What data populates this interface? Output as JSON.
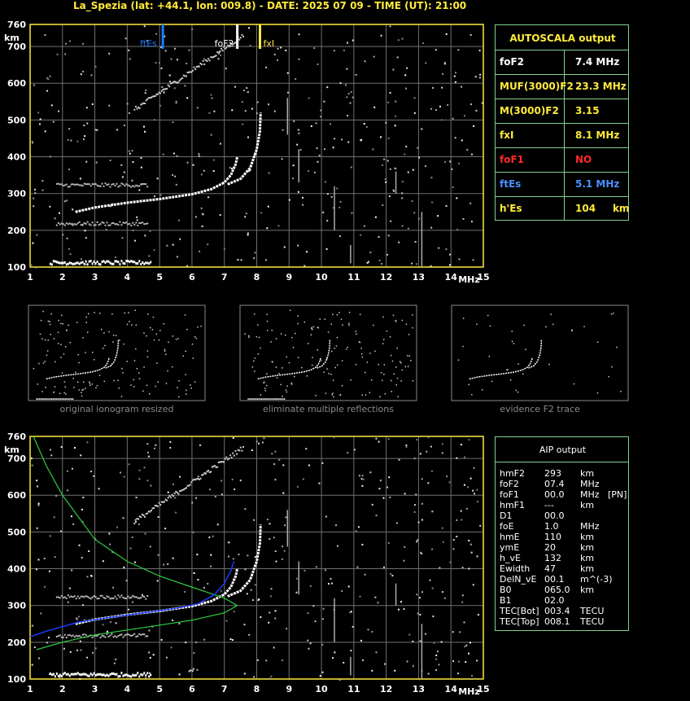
{
  "header": "La_Spezia (lat: +44.1, lon: 009.8) - DATE: 2025 07 09 - TIME (UT): 21:00",
  "colors": {
    "grid": "#6f6f6f",
    "frame": "#ffeb3b",
    "fxi": "#ffeb3b",
    "ftes": "#1e7bff",
    "green": "#2ecc40",
    "blue": "#1d3bff",
    "tableBorder": "#7fd38a"
  },
  "chart_data": [
    {
      "type": "scatter",
      "xlabel": "MHz",
      "ylabel": "km",
      "xlim": [
        1,
        15
      ],
      "ylim": [
        100,
        760
      ],
      "x_ticks": [
        1,
        2,
        3,
        4,
        5,
        6,
        7,
        8,
        9,
        10,
        11,
        12,
        13,
        14,
        15
      ],
      "y_ticks": [
        100,
        200,
        300,
        400,
        500,
        600,
        700,
        760
      ],
      "markers": [
        {
          "name": "ftEs",
          "x": 5.1,
          "color": "#1e7bff"
        },
        {
          "name": "foF2",
          "x": 7.4,
          "color": "#ffffff"
        },
        {
          "name": "fxI",
          "x": 8.1,
          "color": "#ffeb3b"
        }
      ],
      "o_trace": [
        [
          2.4,
          250
        ],
        [
          3,
          262
        ],
        [
          4,
          275
        ],
        [
          5,
          285
        ],
        [
          6,
          298
        ],
        [
          6.6,
          312
        ],
        [
          7,
          330
        ],
        [
          7.2,
          350
        ],
        [
          7.35,
          380
        ],
        [
          7.4,
          400
        ]
      ],
      "x_trace": [
        [
          7.1,
          325
        ],
        [
          7.5,
          340
        ],
        [
          7.8,
          370
        ],
        [
          8,
          420
        ],
        [
          8.1,
          470
        ],
        [
          8.12,
          520
        ]
      ]
    },
    {
      "type": "scatter",
      "xlabel": "MHz",
      "ylabel": "km",
      "xlim": [
        1,
        15
      ],
      "ylim": [
        100,
        760
      ],
      "x_ticks": [
        1,
        2,
        3,
        4,
        5,
        6,
        7,
        8,
        9,
        10,
        11,
        12,
        13,
        14,
        15
      ],
      "y_ticks": [
        100,
        200,
        300,
        400,
        500,
        600,
        700,
        760
      ],
      "profile_green": [
        [
          1.1,
          760
        ],
        [
          1.5,
          680
        ],
        [
          2,
          600
        ],
        [
          3,
          480
        ],
        [
          4,
          420
        ],
        [
          5,
          380
        ],
        [
          6,
          350
        ],
        [
          7,
          320
        ],
        [
          7.4,
          300
        ],
        [
          7,
          280
        ],
        [
          6,
          260
        ],
        [
          4.5,
          240
        ],
        [
          3,
          220
        ],
        [
          2,
          200
        ],
        [
          1.2,
          180
        ]
      ],
      "profile_blue": [
        [
          1,
          215
        ],
        [
          1.5,
          230
        ],
        [
          2.5,
          255
        ],
        [
          3.5,
          268
        ],
        [
          4.5,
          280
        ],
        [
          5.5,
          292
        ],
        [
          6.2,
          305
        ],
        [
          6.7,
          330
        ],
        [
          7,
          360
        ],
        [
          7.2,
          395
        ],
        [
          7.3,
          420
        ]
      ]
    }
  ],
  "autoscala": {
    "title": "AUTOSCALA output",
    "rows": [
      {
        "label": "foF2",
        "value": "7.4 MHz",
        "labelColor": "#ffffff",
        "valueColor": "#ffffff"
      },
      {
        "label": "MUF(3000)F2",
        "value": "23.3 MHz",
        "labelColor": "#ffeb3b",
        "valueColor": "#ffeb3b"
      },
      {
        "label": "M(3000)F2",
        "value": "3.15",
        "labelColor": "#ffeb3b",
        "valueColor": "#ffeb3b"
      },
      {
        "label": "fxI",
        "value": "8.1 MHz",
        "labelColor": "#ffeb3b",
        "valueColor": "#ffeb3b"
      },
      {
        "label": "foF1",
        "value": "NO",
        "labelColor": "#ff2a2a",
        "valueColor": "#ff2a2a"
      },
      {
        "label": "ftEs",
        "value": "5.1 MHz",
        "labelColor": "#4a90ff",
        "valueColor": "#4a90ff"
      },
      {
        "label": "h'Es",
        "value": "104     km",
        "labelColor": "#ffeb3b",
        "valueColor": "#ffeb3b"
      }
    ]
  },
  "thumbnails": [
    {
      "caption": "original ionogram resized"
    },
    {
      "caption": "eliminate multiple reflections"
    },
    {
      "caption": "evidence F2 trace"
    }
  ],
  "aip": {
    "title": "AIP output",
    "rows": [
      [
        "hmF2",
        "293",
        "km",
        ""
      ],
      [
        "foF2",
        "07.4",
        "MHz",
        ""
      ],
      [
        "foF1",
        "00.0",
        "MHz",
        "[PN]"
      ],
      [
        "hmF1",
        "---",
        "km",
        ""
      ],
      [
        "D1",
        "00.0",
        "",
        ""
      ],
      [
        "foE",
        "1.0",
        "MHz",
        ""
      ],
      [
        "hmE",
        "110",
        "km",
        ""
      ],
      [
        "ymE",
        "20",
        "km",
        ""
      ],
      [
        "h_vE",
        "132",
        "km",
        ""
      ],
      [
        "Ewidth",
        "47",
        "km",
        ""
      ],
      [
        "DelN_vE",
        "00.1",
        "m^(-3)",
        ""
      ],
      [
        "B0",
        "065.0",
        "km",
        ""
      ],
      [
        "B1",
        "02.0",
        "",
        ""
      ],
      [
        "TEC[Bot]",
        "003.4",
        "TECU",
        ""
      ],
      [
        "TEC[Top]",
        "008.1",
        "TECU",
        ""
      ]
    ]
  }
}
